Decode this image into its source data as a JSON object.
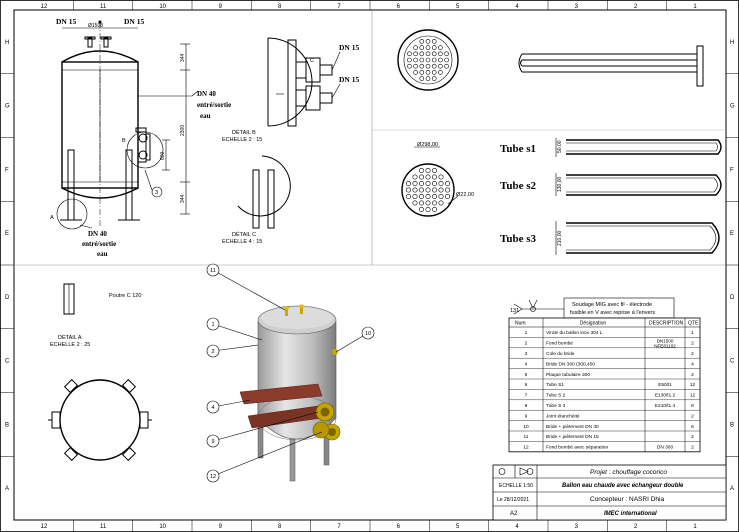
{
  "border": {
    "columns_top": [
      "12",
      "11",
      "10",
      "9",
      "8",
      "7",
      "6",
      "5",
      "4",
      "3",
      "2",
      "1"
    ],
    "columns_bottom": [
      "12",
      "11",
      "10",
      "9",
      "8",
      "7",
      "6",
      "5",
      "4",
      "3",
      "2",
      "1"
    ],
    "rows": [
      "H",
      "G",
      "F",
      "E",
      "D",
      "C",
      "B",
      "A"
    ]
  },
  "front_view": {
    "dn15_left": "DN 15",
    "dn15_right": "DN 15",
    "dim_top": "Ø1508",
    "dn40_side": "DN 40",
    "dn40_side_sub1": "entré/sortie",
    "dn40_side_sub2": "eau",
    "dn40_bottom": "DN 40",
    "dn40_bottom_sub1": "entré/sortie",
    "dn40_bottom_sub2": "eau",
    "dim_344_top": "344",
    "dim_2300": "2300",
    "dim_800": "800",
    "dim_344_bottom": "344",
    "label_A": "A",
    "label_B": "B",
    "callout_3": "3"
  },
  "detail_b": {
    "dn15_top": "DN 15",
    "dn15_bottom": "DN 15",
    "label_C": "C",
    "title": "DÉTAIL B",
    "scale": "ECHELLE 2 : 15"
  },
  "detail_c": {
    "title": "DÉTAIL C",
    "scale": "ECHELLE 4 : 15"
  },
  "detail_a": {
    "beam": "Poutre C 120",
    "title": "DÉTAIL A",
    "scale": "ECHELLE 2 : 25"
  },
  "tube_plate": {
    "dia": "Ø298,00",
    "hole": "Ø22,00"
  },
  "tubes": {
    "s1": "Tube s1",
    "s2": "Tube s2",
    "s3": "Tube s3",
    "s1_dim": "50,00",
    "s2_dim": "130,00",
    "s3_dim": "210,00"
  },
  "iso_callouts": [
    "11",
    "1",
    "2",
    "10",
    "4",
    "9",
    "12"
  ],
  "weld": {
    "code": "131",
    "line1": "Soudage MIG avec fil - électrode",
    "line2": "fusible en V avec reprise à l'envers"
  },
  "bom": {
    "headers": [
      "Num",
      "Désignation",
      "DESCRIPTION",
      "QTE"
    ],
    "rows": [
      {
        "num": "1",
        "des": "Virole du ballon inox 304 L",
        "desc": "",
        "qte": "1"
      },
      {
        "num": "2",
        "des": "Fond bombé",
        "desc": "DN1500 NFE81102",
        "qte": "2"
      },
      {
        "num": "3",
        "des": "Cole du bride",
        "desc": "",
        "qte": "2"
      },
      {
        "num": "4",
        "des": "Bride DN 300 (300,450",
        "desc": "",
        "qte": "4"
      },
      {
        "num": "5",
        "des": "Plaque tubulaire 300",
        "desc": "",
        "qte": "2"
      },
      {
        "num": "6",
        "des": "Tube S1",
        "desc": "E50/l1",
        "qte": "12"
      },
      {
        "num": "7",
        "des": "Tube S 2",
        "desc": "E130/l1.2",
        "qte": "12"
      },
      {
        "num": "8",
        "des": "Tube S 3",
        "desc": "E210/l1.4",
        "qte": "8"
      },
      {
        "num": "9",
        "des": "Joint étanchéité",
        "desc": "",
        "qte": "2"
      },
      {
        "num": "10",
        "des": "Bride + piètement DN 40",
        "desc": "",
        "qte": "6"
      },
      {
        "num": "11",
        "des": "Bride + piètement DN 15",
        "desc": "",
        "qte": "2"
      },
      {
        "num": "12",
        "des": "Fond bombé avec séparation",
        "desc": "DN 300",
        "qte": "2"
      }
    ]
  },
  "title_block": {
    "project": "Projet : chouffage cocorico",
    "scale": "ECHELLE 1:50",
    "subject": "Ballon eau chaude avec échangeur double",
    "date": "Le 28/12/2021",
    "designer": "Concepteur : NASRI Dhia",
    "format": "A2",
    "company": "IMEC international"
  }
}
